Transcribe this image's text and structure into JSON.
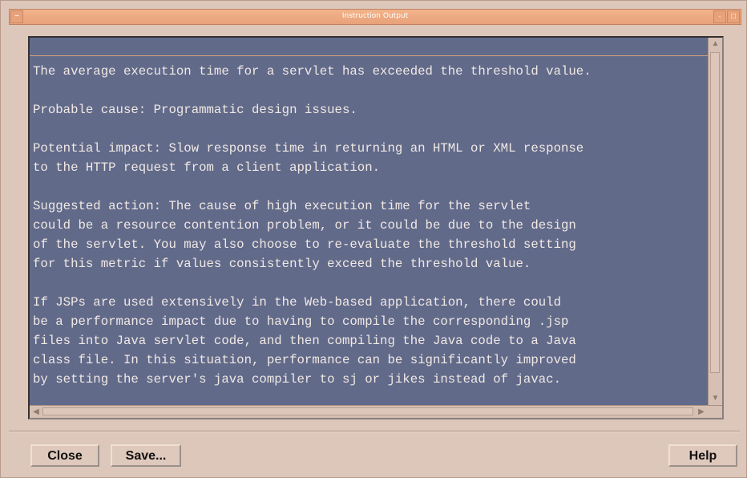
{
  "window": {
    "title": "Instruction Output"
  },
  "output": {
    "text": "The average execution time for a servlet has exceeded the threshold value.\n\nProbable cause: Programmatic design issues.\n\nPotential impact: Slow response time in returning an HTML or XML response\nto the HTTP request from a client application.\n\nSuggested action: The cause of high execution time for the servlet\ncould be a resource contention problem, or it could be due to the design\nof the servlet. You may also choose to re-evaluate the threshold setting\nfor this metric if values consistently exceed the threshold value.\n\nIf JSPs are used extensively in the Web-based application, there could\nbe a performance impact due to having to compile the corresponding .jsp\nfiles into Java servlet code, and then compiling the Java code to a Java\nclass file. In this situation, performance can be significantly improved\nby setting the server's java compiler to sj or jikes instead of javac."
  },
  "buttons": {
    "close": "Close",
    "save": "Save...",
    "help": "Help"
  },
  "colors": {
    "titlebar": "#e8a27a",
    "output_background": "#626a8a",
    "output_text": "#f0e9e4",
    "window_background": "#dcc7ba"
  },
  "icons": {
    "window_menu": "window-menu-icon",
    "minimize": "minimize-icon",
    "maximize": "maximize-icon",
    "scroll_up": "arrow-up-icon",
    "scroll_down": "arrow-down-icon",
    "scroll_left": "arrow-left-icon",
    "scroll_right": "arrow-right-icon"
  }
}
